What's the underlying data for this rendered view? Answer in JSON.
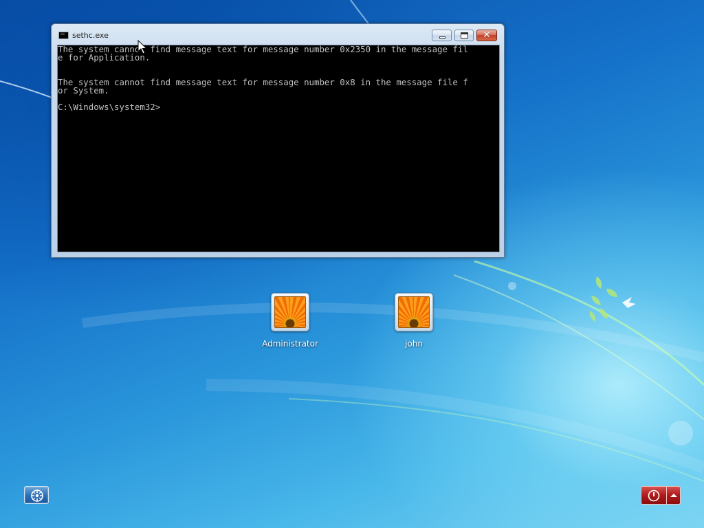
{
  "window": {
    "title": "sethc.exe",
    "close_glyph": "✕",
    "console_lines": [
      "The system cannot find message text for message number 0x2350 in the message fil",
      "e for Application.",
      "",
      "",
      "The system cannot find message text for message number 0x8 in the message file f",
      "or System.",
      "",
      "C:\\Windows\\system32>"
    ]
  },
  "users": [
    {
      "name": "Administrator"
    },
    {
      "name": "john"
    }
  ],
  "icons": {
    "title": "console-icon",
    "ease_of_access": "ease-of-access-icon",
    "shutdown": "power-icon",
    "shutdown_options": "chevron-up-icon",
    "avatar": "flower-avatar-icon"
  },
  "colors": {
    "console_bg": "#000000",
    "console_text": "#c0c0c0",
    "close_button": "#c14128",
    "shutdown_button": "#b01a1a"
  }
}
